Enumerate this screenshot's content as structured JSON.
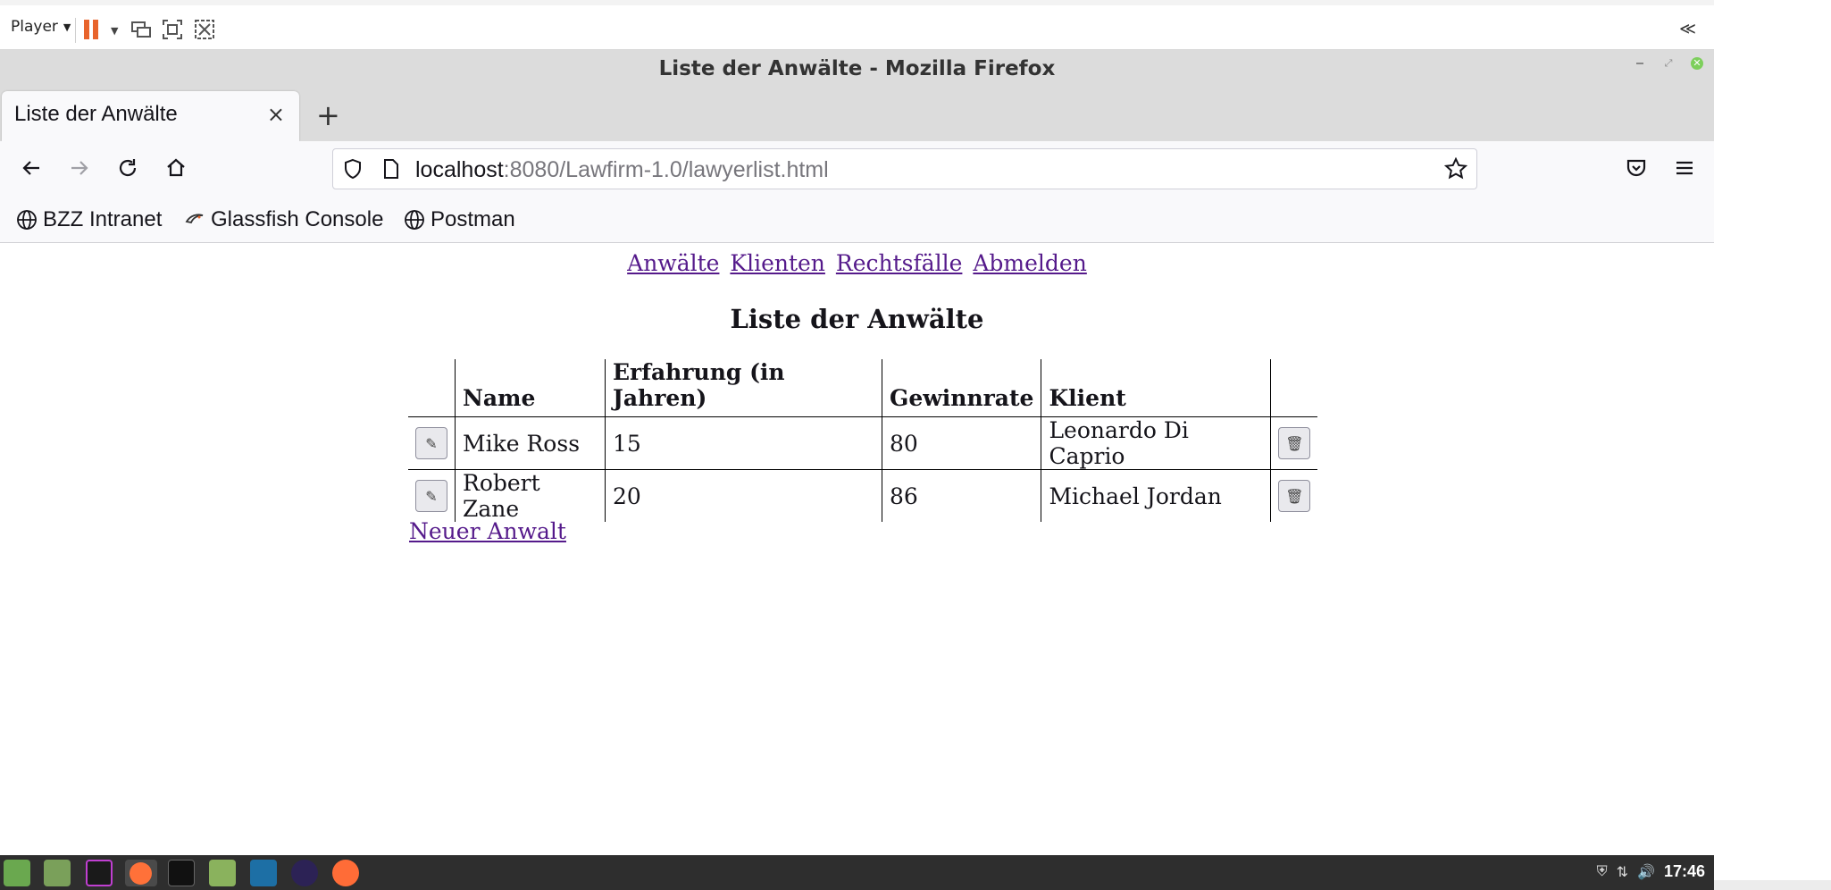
{
  "player": {
    "menu_label": "Player",
    "collapse_glyph": "≪"
  },
  "window": {
    "title": "Liste der Anwälte - Mozilla Firefox"
  },
  "tabs": [
    {
      "title": "Liste der Anwälte",
      "close_glyph": "×"
    }
  ],
  "new_tab_glyph": "+",
  "urlbar": {
    "host": "localhost",
    "path": ":8080/Lawfirm-1.0/lawyerlist.html"
  },
  "bookmarks": [
    {
      "label": "BZZ Intranet",
      "icon": "globe-icon"
    },
    {
      "label": "Glassfish Console",
      "icon": "glassfish-icon"
    },
    {
      "label": "Postman",
      "icon": "globe-icon"
    }
  ],
  "page": {
    "nav": [
      "Anwälte",
      "Klienten",
      "Rechtsfälle",
      "Abmelden"
    ],
    "heading": "Liste der Anwälte",
    "table": {
      "headers": [
        "",
        "Name",
        "Erfahrung (in Jahren)",
        "Gewinnrate",
        "Klient",
        ""
      ],
      "rows": [
        {
          "name": "Mike Ross",
          "experience": "15",
          "winrate": "80",
          "client": "Leonardo Di Caprio"
        },
        {
          "name": "Robert Zane",
          "experience": "20",
          "winrate": "86",
          "client": "Michael Jordan"
        }
      ],
      "edit_glyph": "✎",
      "delete_glyph": "🗑"
    },
    "new_link": "Neuer Anwalt"
  },
  "taskbar": {
    "clock": "17:46",
    "apps": [
      "mint-menu-icon",
      "files-icon",
      "intellij-icon",
      "firefox-icon",
      "terminal-icon",
      "folder-icon",
      "mysql-workbench-icon",
      "eclipse-icon",
      "postman-icon"
    ]
  },
  "colors": {
    "link_visited": "#551a8b",
    "pause_orange": "#e8642c",
    "taskbar_bg": "#2e2e2e"
  }
}
